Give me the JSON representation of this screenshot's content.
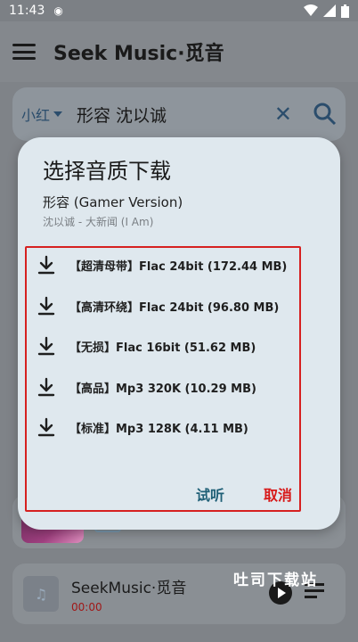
{
  "status_bar": {
    "time": "11:43"
  },
  "app": {
    "title": "Seek Music·觅音"
  },
  "search": {
    "source": "小红",
    "query": "形容 沈以诚"
  },
  "dialog": {
    "title": "选择音质下载",
    "song": "形容 (Gamer Version)",
    "artist_album": "沈以诚 - 大新闻 (I Am)",
    "options": [
      {
        "label": "【超清母带】Flac 24bit (172.44 MB)"
      },
      {
        "label": "【高清环绕】Flac 24bit (96.80 MB)"
      },
      {
        "label": "【无损】Flac 16bit (51.62 MB)"
      },
      {
        "label": "【高品】Mp3 320K (10.29 MB)"
      },
      {
        "label": "【标准】Mp3 128K (4.11 MB)"
      }
    ],
    "listen_label": "试听",
    "cancel_label": "取消"
  },
  "player": {
    "name": "SeekMusic·觅音",
    "time": "00:00"
  },
  "watermark": "吐司下载站",
  "colors": {
    "accent": "#1f5f76",
    "danger": "#d81818",
    "dialog_bg": "#dfe8ee"
  }
}
